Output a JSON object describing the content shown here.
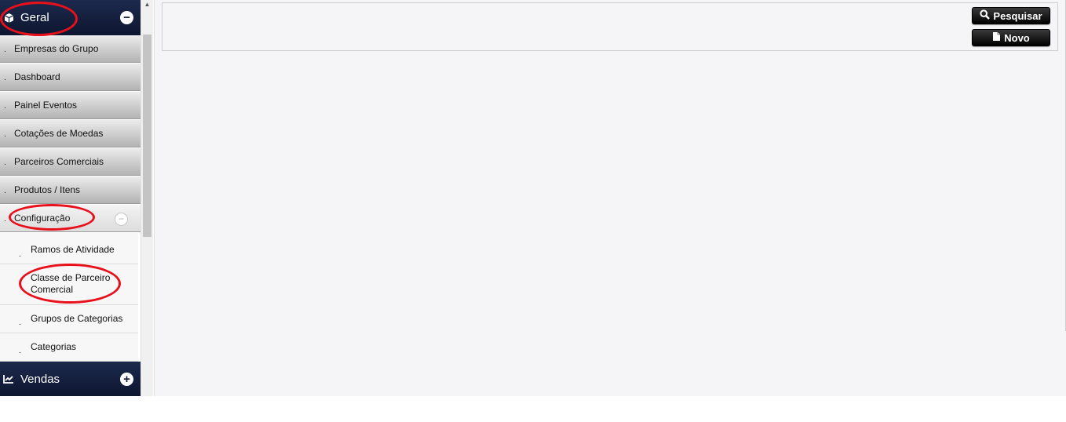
{
  "sidebar": {
    "sections": [
      {
        "title": "Geral",
        "icon": "cube-icon",
        "toggle": "minus"
      },
      {
        "title": "Vendas",
        "icon": "line-chart-icon",
        "toggle": "plus"
      }
    ],
    "items": [
      {
        "label": "Empresas do Grupo"
      },
      {
        "label": "Dashboard"
      },
      {
        "label": "Painel Eventos"
      },
      {
        "label": "Cotações de Moedas"
      },
      {
        "label": "Parceiros Comerciais"
      },
      {
        "label": "Produtos / Itens"
      },
      {
        "label": "Configuração"
      }
    ],
    "subitems": [
      {
        "label": "Ramos de Atividade"
      },
      {
        "label": "Classe de Parceiro Comercial"
      },
      {
        "label": "Grupos de Categorias"
      },
      {
        "label": "Categorias"
      }
    ],
    "bullet": "."
  },
  "toolbar": {
    "search_label": "Pesquisar",
    "new_label": "Novo"
  },
  "colors": {
    "sidebar_header": "#101a36",
    "annotation": "#e8111b",
    "main_background": "#f5f5f7"
  }
}
